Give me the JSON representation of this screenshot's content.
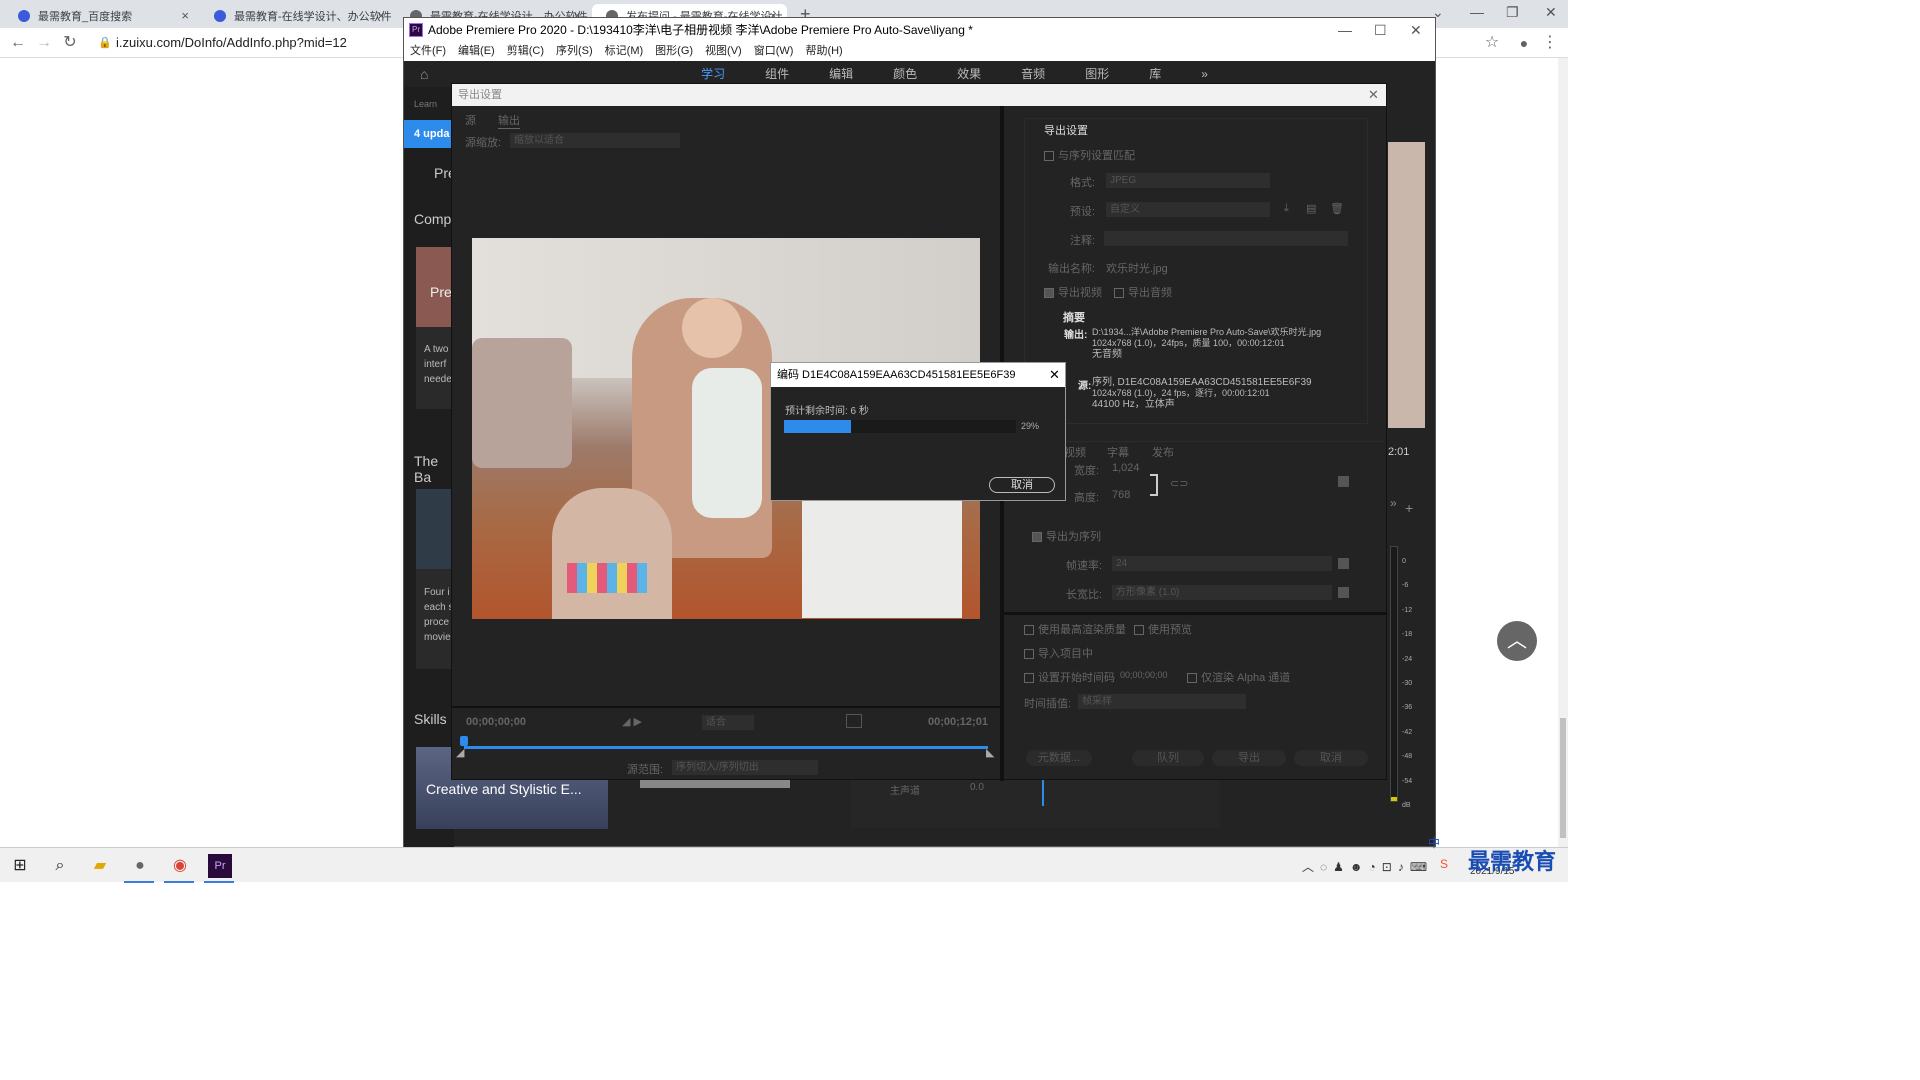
{
  "browser": {
    "tabs": [
      {
        "label": "最需教育_百度搜索",
        "fav": "#3b5bdb"
      },
      {
        "label": "最需教育-在线学设计、办公软件",
        "fav": "#3b5bdb"
      },
      {
        "label": "最需教育-在线学设计、办公软件",
        "fav": "#666"
      },
      {
        "label": "发布提问 - 最需教育-在线学设计",
        "fav": "#666"
      }
    ],
    "new_tab": "+",
    "url": "i.zuixu.com/DoInfo/AddInfo.php?mid=12"
  },
  "premiere": {
    "title": "Adobe Premiere Pro 2020 - D:\\193410李洋\\电子相册视频 李洋\\Adobe Premiere Pro Auto-Save\\liyang *",
    "menu": [
      "文件(F)",
      "编辑(E)",
      "剪辑(C)",
      "序列(S)",
      "标记(M)",
      "图形(G)",
      "视图(V)",
      "窗口(W)",
      "帮助(H)"
    ],
    "workspaces": [
      "学习",
      "组件",
      "编辑",
      "颜色",
      "效果",
      "音频",
      "图形",
      "库"
    ],
    "active_workspace": "学习",
    "learn": {
      "header": "Learn",
      "updates": "4 upda",
      "pr_label": "Pre",
      "section1": "Comp",
      "card1_img": "Pre",
      "card1_text": [
        "A two",
        "interf",
        "neede"
      ],
      "section2": "The Ba",
      "card2_text": [
        "Four i",
        "each s",
        "proce",
        "movie"
      ],
      "section3": "Skills",
      "card3_title": "Creative and Stylistic E..."
    },
    "timecode_right": "2:01",
    "meter_ticks": [
      "0",
      "-6",
      "-12",
      "-18",
      "-24",
      "-30",
      "-36",
      "-42",
      "-48",
      "-54",
      "dB"
    ],
    "bottom_track": {
      "label": "主声道",
      "value": "0.0"
    }
  },
  "export": {
    "title": "导出设置",
    "tabs": [
      "源",
      "输出"
    ],
    "source_scale_label": "源缩放:",
    "source_scale_value": "缩放以适合",
    "timecode_start": "00;00;00;00",
    "timecode_end": "00;00;12;01",
    "fit_label": "适合",
    "range_label": "源范围:",
    "range_value": "序列切入/序列切出",
    "settings": {
      "header": "导出设置",
      "match_seq": "与序列设置匹配",
      "format_label": "格式:",
      "format_value": "JPEG",
      "preset_label": "预设:",
      "preset_value": "自定义",
      "comment_label": "注释:",
      "output_name_label": "输出名称:",
      "output_name_value": "欢乐时光.jpg",
      "export_video": "导出视频",
      "export_audio": "导出音频",
      "summary_header": "摘要",
      "output_label": "输出:",
      "output_lines": [
        "D:\\1934...洋\\Adobe Premiere Pro Auto-Save\\欢乐时光.jpg",
        "1024x768 (1.0)，24fps，质量 100，00:00:12:01",
        "无音频"
      ],
      "source_label": "源:",
      "source_lines": [
        "序列, D1E4C08A159EAA63CD451581EE5E6F39",
        "1024x768 (1.0)，24 fps，逐行，00:00:12:01",
        "44100 Hz，立体声"
      ]
    },
    "subtabs": [
      "视频",
      "字幕",
      "发布"
    ],
    "width_label": "宽度:",
    "width_value": "1,024",
    "height_label": "高度:",
    "height_value": "768",
    "export_as_seq": "导出为序列",
    "fps_label": "帧速率:",
    "fps_value": "24",
    "aspect_label": "长宽比:",
    "aspect_value": "方形像素 (1.0)",
    "opts": {
      "max_quality": "使用最高渲染质量",
      "use_preview": "使用预览",
      "import_project": "导入项目中",
      "start_tc": "设置开始时间码",
      "start_tc_value": "00;00;00;00",
      "alpha_only": "仅渲染 Alpha 通道",
      "interp_label": "时间插值:",
      "interp_value": "帧采样"
    },
    "buttons": [
      "元数据...",
      "队列",
      "导出",
      "取消"
    ]
  },
  "encode": {
    "title": "编码 D1E4C08A159EAA63CD451581EE5E6F39",
    "remaining": "预计剩余时间: 6 秒",
    "progress": 0.29,
    "percent_text": "29%",
    "cancel": "取消"
  },
  "taskbar": {
    "time": "",
    "date": "2021/9/15",
    "ime": "中",
    "watermark": "最需教育"
  }
}
